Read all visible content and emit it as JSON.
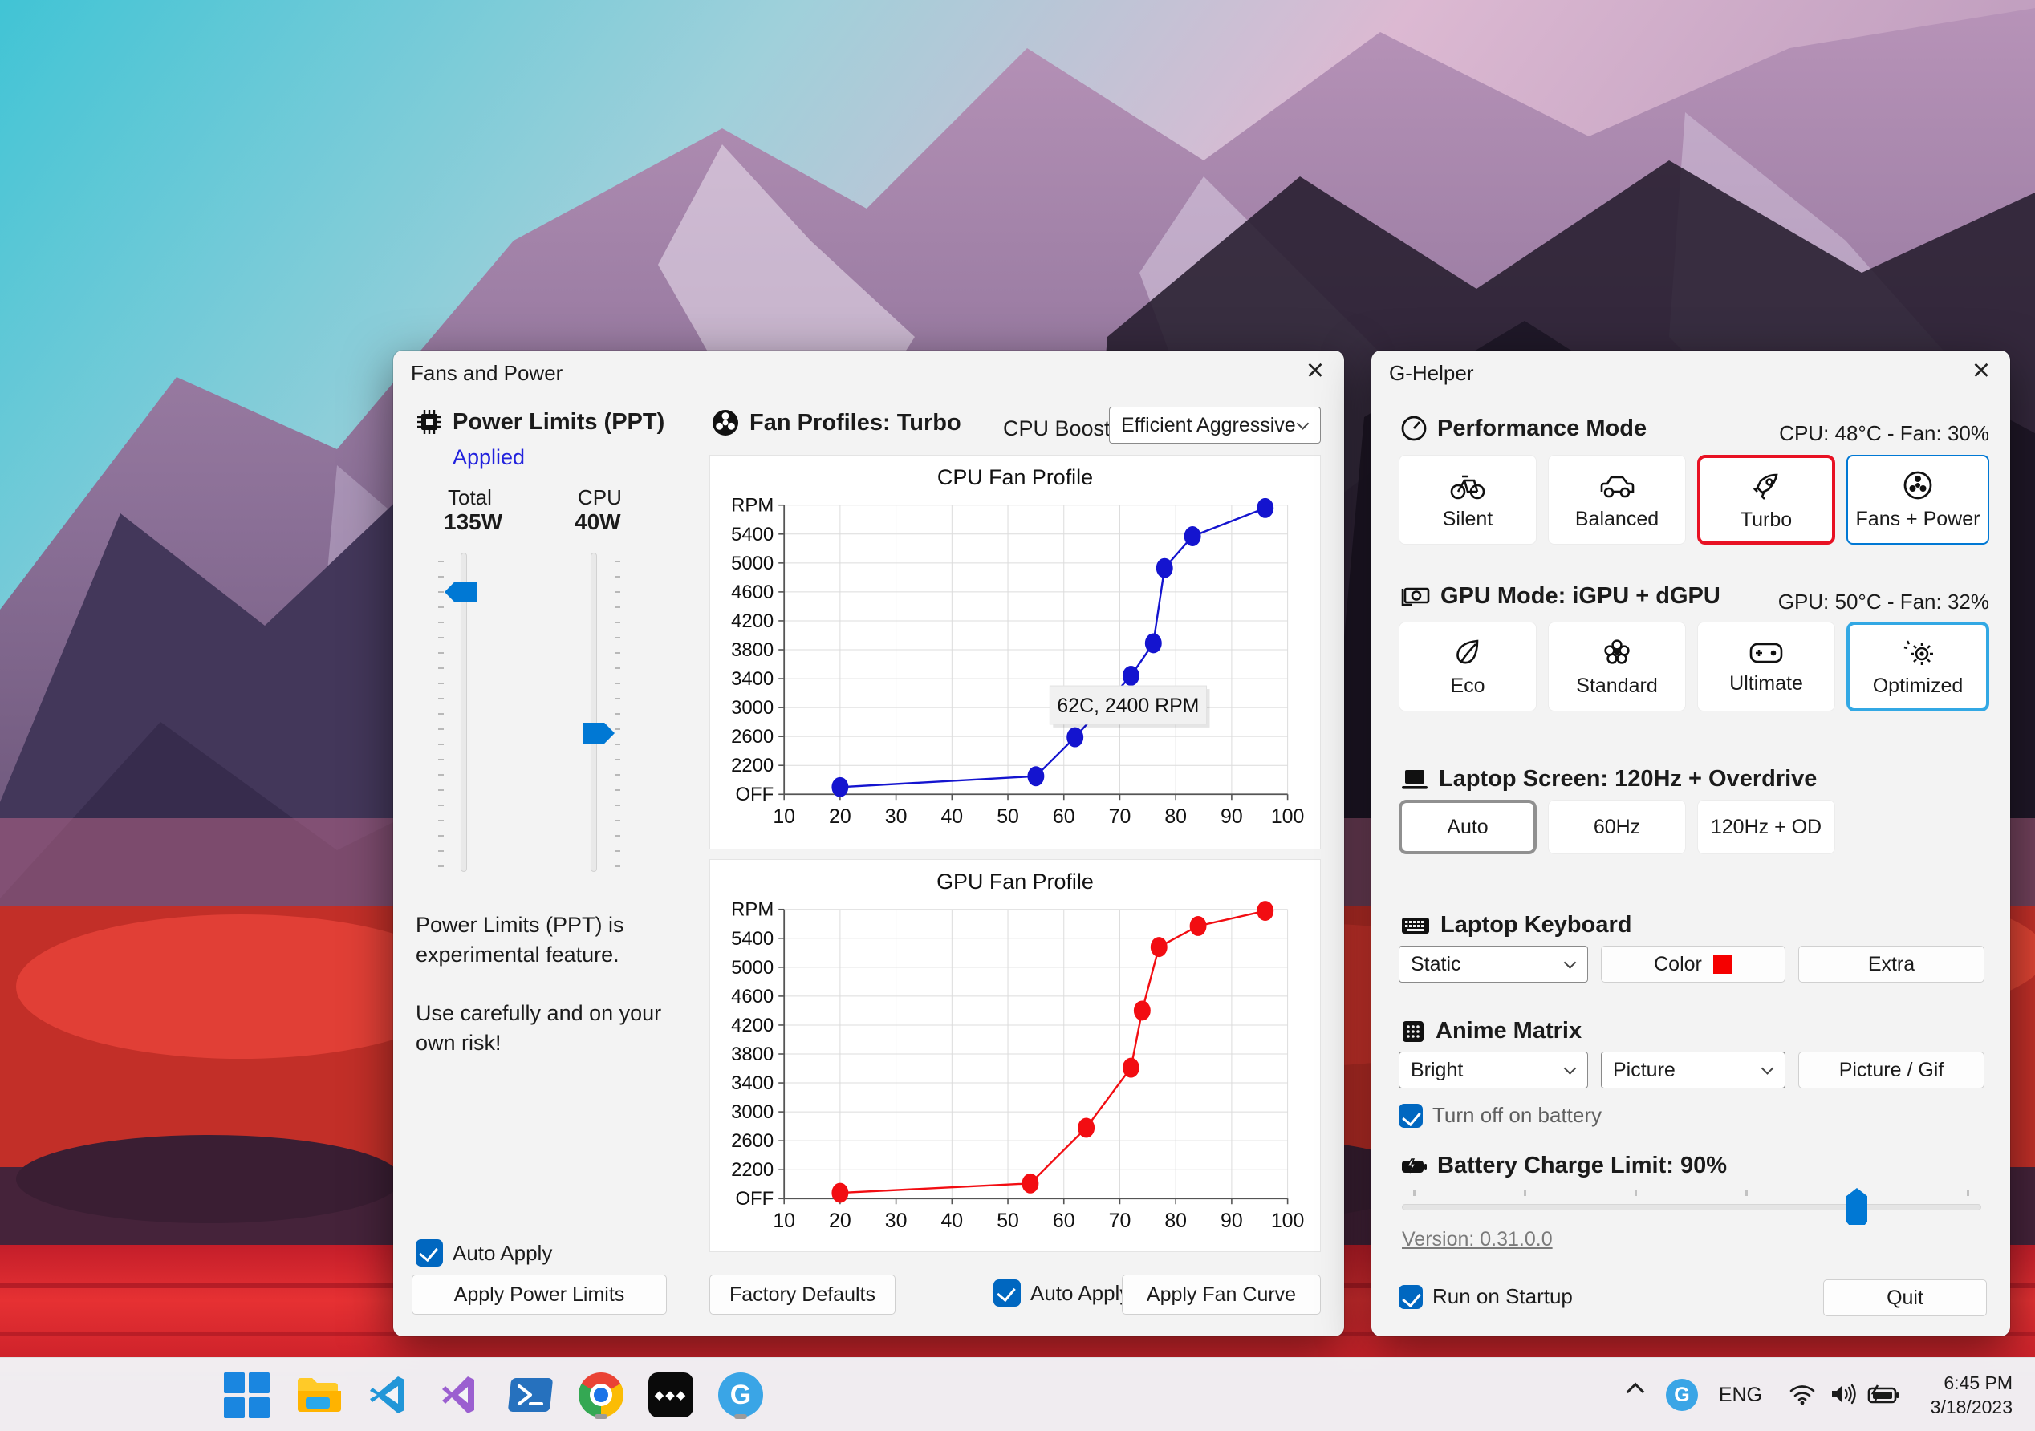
{
  "fans_window": {
    "title": "Fans and Power",
    "close": "×",
    "power": {
      "header": "Power Limits (PPT)",
      "applied": "Applied",
      "total_label": "Total",
      "total_value": "135W",
      "cpu_label": "CPU",
      "cpu_value": "40W",
      "warning1": "Power Limits (PPT) is experimental feature.",
      "warning2": "Use carefully and on your own risk!",
      "auto_apply": "Auto Apply",
      "apply_button": "Apply Power Limits"
    },
    "fans": {
      "header": "Fan Profiles: Turbo",
      "cpu_boost_label": "CPU Boost",
      "cpu_boost_value": "Efficient Aggressive",
      "factory_button": "Factory Defaults",
      "auto_apply": "Auto Apply",
      "apply_button": "Apply Fan Curve"
    }
  },
  "ghelper_window": {
    "title": "G-Helper",
    "close": "×",
    "performance": {
      "header": "Performance Mode",
      "temps": "CPU: 48°C -  Fan: 30%",
      "buttons": [
        {
          "label": "Silent"
        },
        {
          "label": "Balanced"
        },
        {
          "label": "Turbo"
        },
        {
          "label": "Fans + Power"
        }
      ]
    },
    "gpu": {
      "header": "GPU Mode: iGPU + dGPU",
      "temps": "GPU: 50°C -  Fan: 32%",
      "buttons": [
        {
          "label": "Eco"
        },
        {
          "label": "Standard"
        },
        {
          "label": "Ultimate"
        },
        {
          "label": "Optimized"
        }
      ]
    },
    "screen": {
      "header": "Laptop Screen: 120Hz + Overdrive",
      "buttons": [
        {
          "label": "Auto"
        },
        {
          "label": "60Hz"
        },
        {
          "label": "120Hz + OD"
        }
      ]
    },
    "keyboard": {
      "header": "Laptop Keyboard",
      "mode_value": "Static",
      "color_label": "Color",
      "extra_label": "Extra"
    },
    "matrix": {
      "header": "Anime Matrix",
      "brightness_value": "Bright",
      "mode_value": "Picture",
      "picture_button": "Picture / Gif",
      "battery_checkbox": "Turn off on battery"
    },
    "battery": {
      "header": "Battery Charge Limit: 90%"
    },
    "version": "Version: 0.31.0.0",
    "startup_checkbox": "Run on Startup",
    "quit_button": "Quit"
  },
  "taskbar": {
    "tray": {
      "lang": "ENG",
      "time": "6:45 PM",
      "date": "3/18/2023"
    }
  },
  "chart_data": [
    {
      "type": "line",
      "title": "CPU Fan Profile",
      "color": "#1414cf",
      "ylabel": "RPM",
      "x": [
        20,
        55,
        62,
        72,
        76,
        78,
        83,
        96
      ],
      "y": [
        1900,
        2050,
        2590,
        3440,
        3890,
        4930,
        5370,
        5760
      ],
      "xticks": [
        10,
        20,
        30,
        40,
        50,
        60,
        70,
        80,
        90,
        100
      ],
      "ylabels": [
        "OFF",
        "2200",
        "2600",
        "3000",
        "3400",
        "3800",
        "4200",
        "4600",
        "5000",
        "5400",
        "RPM"
      ],
      "ymin": 1800,
      "ymax": 5800,
      "grid": true,
      "legend": "none",
      "tooltip": {
        "text": "62C, 2400 RPM",
        "tx": 57.5,
        "ty": 3300
      }
    },
    {
      "type": "line",
      "title": "GPU Fan Profile",
      "color": "#f20d12",
      "ylabel": "RPM",
      "x": [
        20,
        54,
        64,
        72,
        74,
        77,
        84,
        96
      ],
      "y": [
        1880,
        2010,
        2780,
        3610,
        4400,
        5280,
        5570,
        5780
      ],
      "xticks": [
        10,
        20,
        30,
        40,
        50,
        60,
        70,
        80,
        90,
        100
      ],
      "ylabels": [
        "OFF",
        "2200",
        "2600",
        "3000",
        "3400",
        "3800",
        "4200",
        "4600",
        "5000",
        "5400",
        "RPM"
      ],
      "ymin": 1800,
      "ymax": 5800,
      "grid": true,
      "legend": "none"
    }
  ]
}
